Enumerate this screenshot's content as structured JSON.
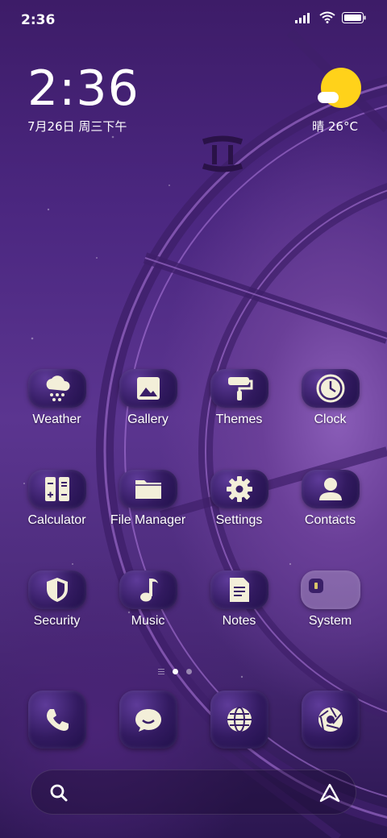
{
  "status": {
    "time": "2:36"
  },
  "clock": {
    "time": "2:36",
    "date": "7月26日 周三下午"
  },
  "weather": {
    "text": "晴 26°C"
  },
  "apps": [
    {
      "label": "Weather",
      "icon": "weather-snow-cloud-icon"
    },
    {
      "label": "Gallery",
      "icon": "gallery-image-icon"
    },
    {
      "label": "Themes",
      "icon": "paint-roller-icon"
    },
    {
      "label": "Clock",
      "icon": "clock-icon"
    },
    {
      "label": "Calculator",
      "icon": "calculator-icon"
    },
    {
      "label": "File Manager",
      "icon": "folder-icon"
    },
    {
      "label": "Settings",
      "icon": "gear-icon"
    },
    {
      "label": "Contacts",
      "icon": "person-icon"
    },
    {
      "label": "Security",
      "icon": "shield-icon"
    },
    {
      "label": "Music",
      "icon": "music-note-icon"
    },
    {
      "label": "Notes",
      "icon": "note-icon"
    },
    {
      "label": "System",
      "icon": "folder-icon"
    }
  ],
  "dock": [
    {
      "icon": "phone-icon"
    },
    {
      "icon": "message-bubble-icon"
    },
    {
      "icon": "browser-globe-icon"
    },
    {
      "icon": "camera-shutter-icon"
    }
  ],
  "colors": {
    "accent": "#ffd21a",
    "icon_fg": "#f3efd9"
  }
}
